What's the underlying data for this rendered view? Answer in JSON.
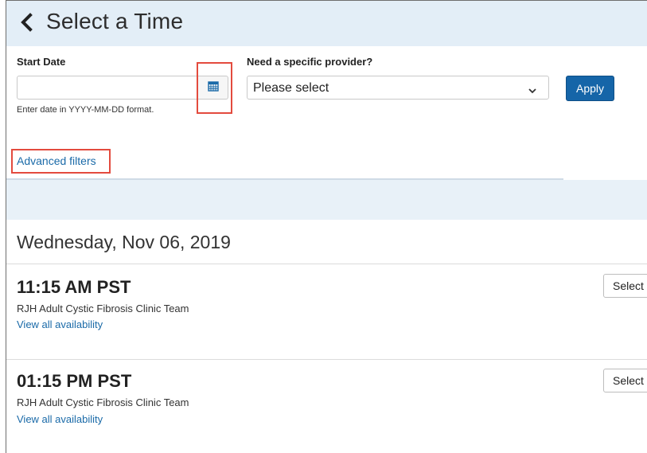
{
  "header": {
    "title": "Select a Time"
  },
  "filters": {
    "start_date_label": "Start Date",
    "start_date_value": "",
    "start_date_hint": "Enter date in YYYY-MM-DD format.",
    "provider_label": "Need a specific provider?",
    "provider_selected": "Please select",
    "apply_label": "Apply",
    "advanced_filters_label": "Advanced filters"
  },
  "results": {
    "day_heading": "Wednesday, Nov 06, 2019",
    "slots": [
      {
        "time": "11:15 AM PST",
        "team": "RJH Adult Cystic Fibrosis Clinic Team",
        "link": "View all availability",
        "button": "Select"
      },
      {
        "time": "01:15 PM PST",
        "team": "RJH Adult Cystic Fibrosis Clinic Team",
        "link": "View all availability",
        "button": "Select"
      }
    ]
  },
  "icons": {
    "back": "chevron-left-icon",
    "calendar": "calendar-icon",
    "dropdown": "chevron-down-icon"
  },
  "colors": {
    "header_bg": "#e3eef7",
    "accent": "#1565a8",
    "link": "#1a6aa8",
    "highlight": "#e34b3e"
  }
}
